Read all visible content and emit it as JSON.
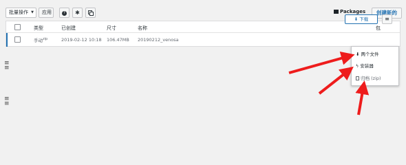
{
  "toolbar": {
    "bulk_actions_label": "批量操作",
    "apply_label": "应用",
    "help_icon": "question-icon",
    "settings_icon": "gear-icon",
    "copy_icon": "copy-icon",
    "packages_label": "Packages",
    "create_new_label": "创建新的"
  },
  "table": {
    "headers": {
      "type": "类型",
      "created": "已创建",
      "size": "尺寸",
      "name": "名称",
      "package": "包"
    },
    "rows": [
      {
        "type": "手动",
        "type_sup": "zip",
        "created": "2019-02-12 10:18",
        "size": "106.47MB",
        "name": "20190212_venosa",
        "download_label": "下载"
      }
    ]
  },
  "dropdown": {
    "items": [
      {
        "label": "两个文件",
        "icon": "download-icon"
      },
      {
        "label": "安装器",
        "icon": "bolt-icon"
      },
      {
        "label": "归档 (zip)",
        "icon": "archive-file-icon"
      }
    ]
  },
  "colors": {
    "accent": "#2271b1",
    "arrow": "#ee1c1c"
  }
}
